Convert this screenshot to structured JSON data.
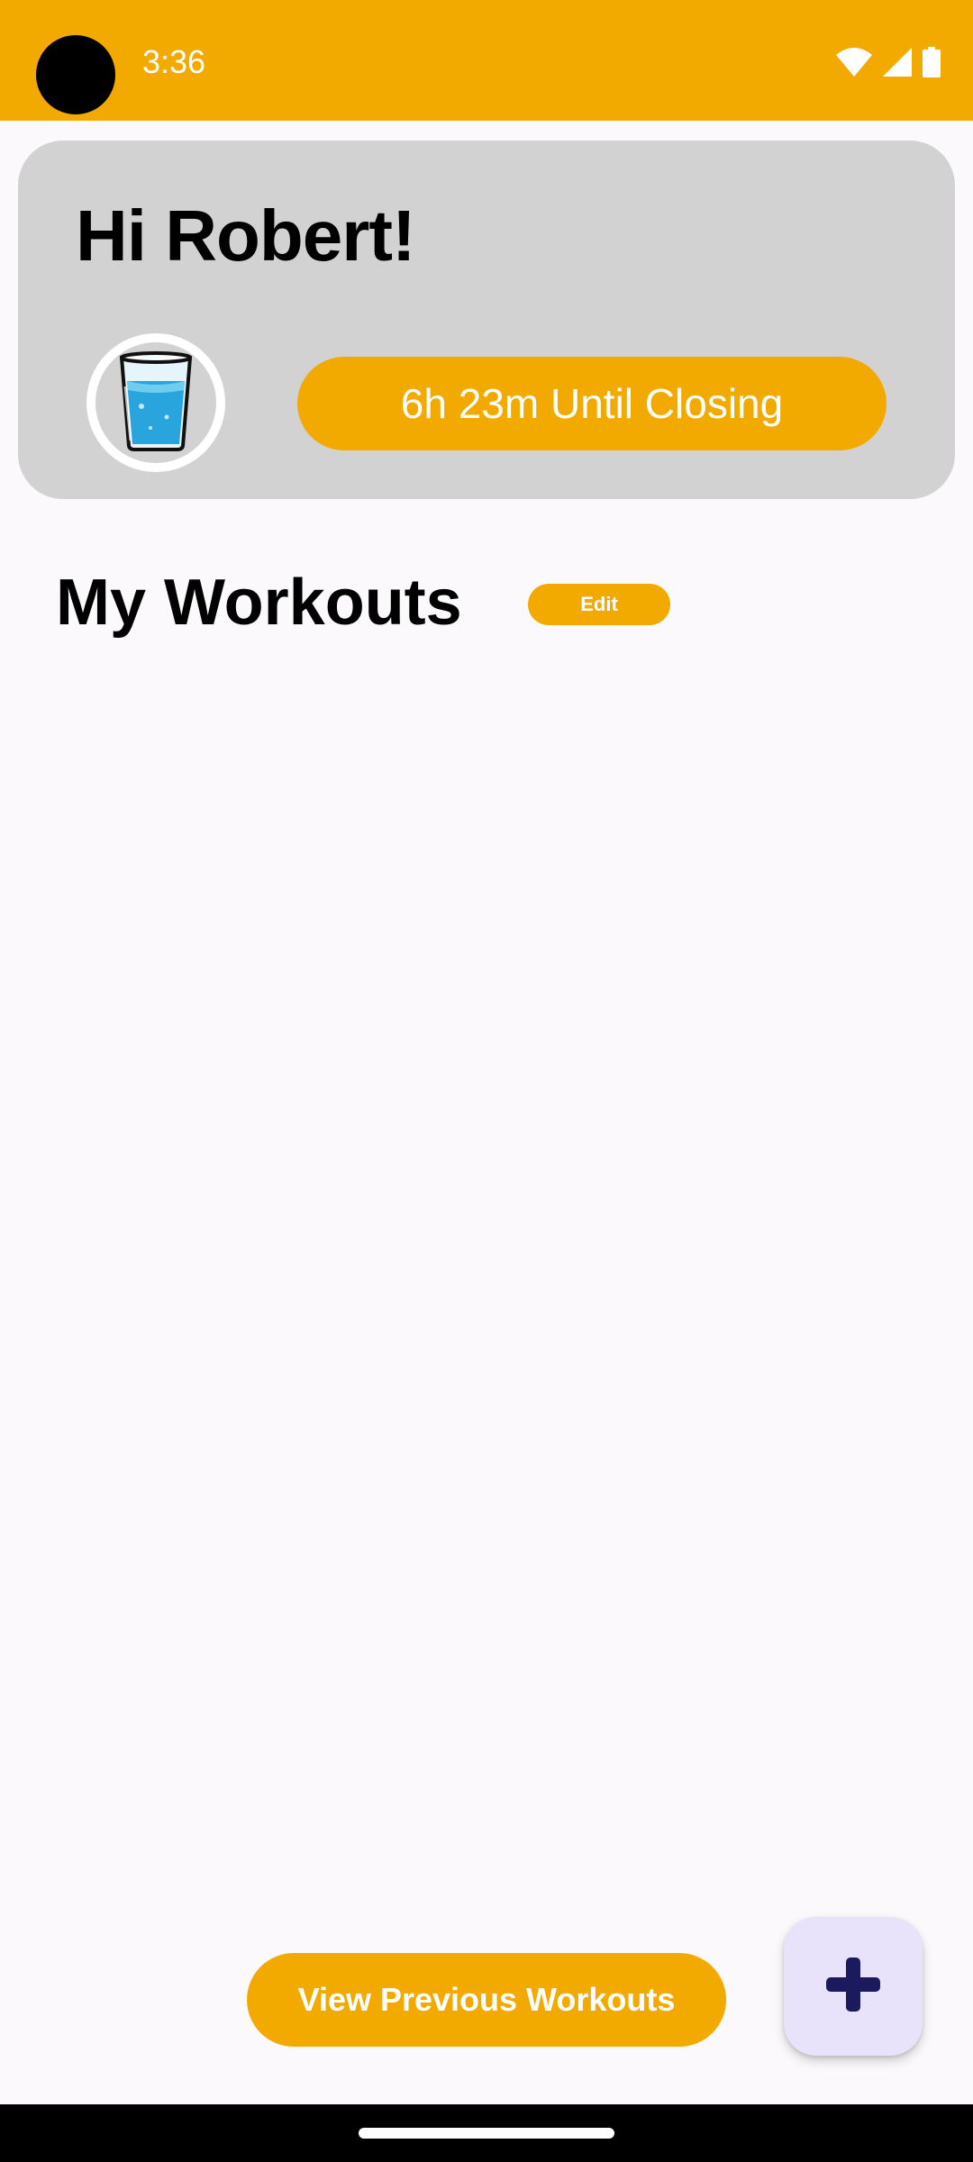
{
  "status_bar": {
    "time": "3:36",
    "background": "#f2aa00",
    "icons": [
      "wifi-icon",
      "signal-icon",
      "battery-icon"
    ]
  },
  "greeting": {
    "title": "Hi Robert!",
    "avatar_icon": "water-glass-icon",
    "closing_label": "6h 23m Until Closing"
  },
  "workouts": {
    "title": "My Workouts",
    "edit_label": "Edit",
    "items": []
  },
  "footer": {
    "previous_label": "View Previous Workouts",
    "fab_icon": "plus-icon"
  },
  "colors": {
    "accent": "#f2aa00",
    "card": "#d2d2d2",
    "fab": "#e8e2fb",
    "fab_icon": "#1c1a5e"
  }
}
